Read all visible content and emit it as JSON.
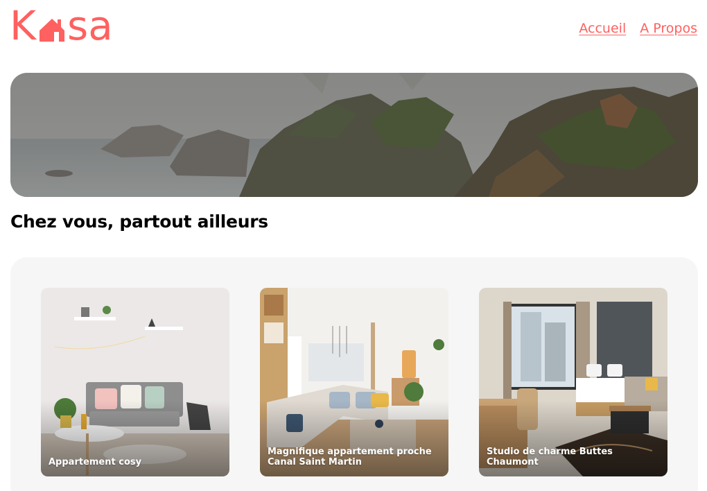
{
  "brand": {
    "logo_left": "K",
    "logo_right": "sa",
    "accent_color": "#FF6060"
  },
  "nav": {
    "items": [
      {
        "label": "Accueil"
      },
      {
        "label": "A Propos"
      }
    ]
  },
  "banner": {
    "tagline": "Chez vous, partout ailleurs",
    "image": "misty-rocky-coastline"
  },
  "gallery": {
    "background": "#F6F6F6",
    "cards": [
      {
        "title": "Appartement cosy",
        "image": "living-room-grey-sofa"
      },
      {
        "title": "Magnifique appartement proche Canal Saint Martin",
        "image": "living-room-corner-sofa"
      },
      {
        "title": "Studio de charme Buttes Chaumont",
        "image": "hotel-bedroom"
      }
    ]
  }
}
